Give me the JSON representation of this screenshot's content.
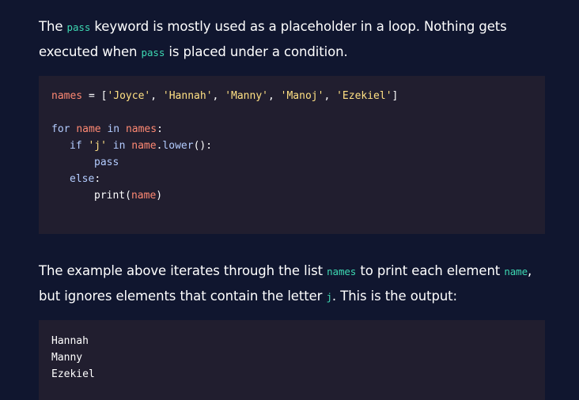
{
  "intro": {
    "t1": "The ",
    "c1": "pass",
    "t2": " keyword is mostly used as a placeholder in a loop. Nothing gets executed when ",
    "c2": "pass",
    "t3": " is placed under a condition."
  },
  "code": {
    "line1": {
      "var": "names",
      "eq": " = [",
      "s1": "'Joyce'",
      "sep1": ", ",
      "s2": "'Hannah'",
      "sep2": ", ",
      "s3": "'Manny'",
      "sep3": ", ",
      "s4": "'Manoj'",
      "sep4": ", ",
      "s5": "'Ezekiel'",
      "close": "]"
    },
    "line2": {
      "kw_for": "for",
      "var_name": "name",
      "kw_in": "in",
      "var_names": "names",
      "colon": ":"
    },
    "line3": {
      "kw_if": "if",
      "str_j": "'j'",
      "kw_in": "in",
      "var_name": "name",
      "dot": ".",
      "fn_lower": "lower",
      "rest": "():"
    },
    "line4": {
      "kw_pass": "pass"
    },
    "line5": {
      "kw_else": "else",
      "colon": ":"
    },
    "line6": {
      "fn_print": "print",
      "open": "(",
      "var_name": "name",
      "close": ")"
    }
  },
  "explanation": {
    "t1": "The example above iterates through the list ",
    "c1": "names",
    "t2": " to print each element ",
    "c2": "name",
    "t3": ", but ignores elements that contain the letter ",
    "c3": "j",
    "t4": ". This is the output:"
  },
  "output": {
    "lines": [
      "Hannah",
      "Manny",
      "Ezekiel"
    ]
  },
  "colors": {
    "background": "#10162f",
    "code_background": "#211e2f",
    "inline_code": "#3dd9b3",
    "keyword": "#b3ccff",
    "variable": "#ff8973",
    "string": "#ffe083"
  }
}
